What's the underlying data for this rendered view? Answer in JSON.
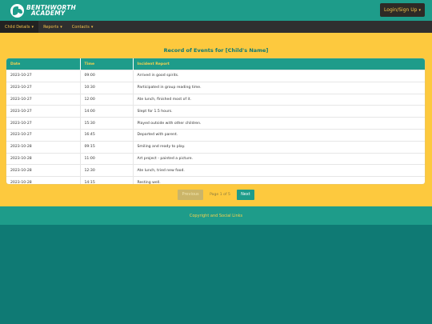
{
  "header": {
    "logo_line1": "BENTHWORTH",
    "logo_line2": "ACADEMY",
    "login_label": "Login/Sign Up"
  },
  "nav": {
    "items": [
      {
        "label": "Child Details"
      },
      {
        "label": "Reports"
      },
      {
        "label": "Contacts"
      }
    ]
  },
  "main": {
    "title": "Record of Events for [Child's Name]",
    "columns": [
      "Date",
      "Time",
      "Incident Report"
    ],
    "rows": [
      [
        "2023-10-27",
        "09:00",
        "Arrived in good spirits."
      ],
      [
        "2023-10-27",
        "10:30",
        "Participated in group reading time."
      ],
      [
        "2023-10-27",
        "12:00",
        "Ate lunch, finished most of it."
      ],
      [
        "2023-10-27",
        "14:00",
        "Slept for 1.5 hours."
      ],
      [
        "2023-10-27",
        "15:30",
        "Played outside with other children."
      ],
      [
        "2023-10-27",
        "16:45",
        "Departed with parent."
      ],
      [
        "2023-10-28",
        "09:15",
        "Smiling and ready to play."
      ],
      [
        "2023-10-28",
        "11:00",
        "Art project - painted a picture."
      ],
      [
        "2023-10-28",
        "12:30",
        "Ate lunch, tried new food."
      ],
      [
        "2023-10-28",
        "14:15",
        "Resting well."
      ]
    ],
    "pagination": {
      "previous_label": "Previous",
      "page_info": "Page 1 of 5",
      "next_label": "Next"
    }
  },
  "footer": {
    "text": "Copyright and Social Links"
  },
  "colors": {
    "teal": "#1e9c8a",
    "dark_teal": "#0f7a74",
    "yellow": "#fdc93e",
    "nav_dark": "#2f2f2f"
  }
}
